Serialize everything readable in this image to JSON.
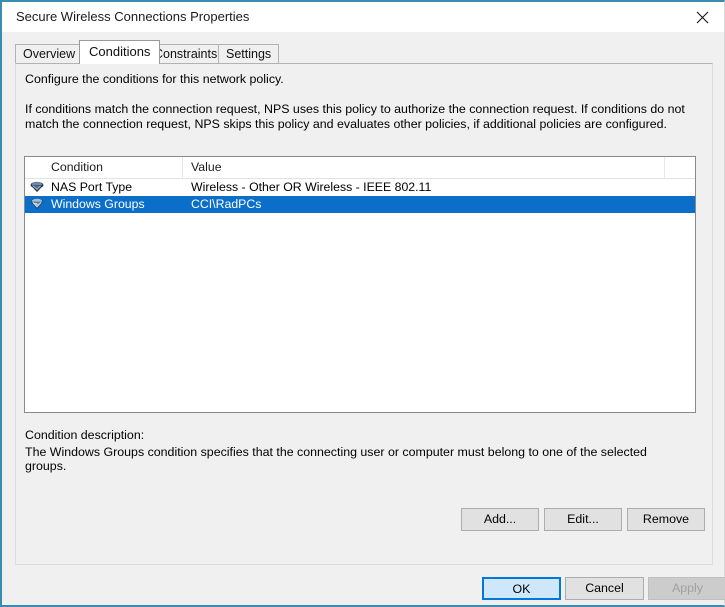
{
  "window": {
    "title": "Secure Wireless Connections Properties",
    "close_icon": "close-icon",
    "accent_border": "#3a8db0",
    "body_bg": "#f0f0f0"
  },
  "tabs": [
    {
      "label": "Overview",
      "selected": false
    },
    {
      "label": "Conditions",
      "selected": true
    },
    {
      "label": "Constraints",
      "selected": false
    },
    {
      "label": "Settings",
      "selected": false
    }
  ],
  "panel": {
    "intro_line1": "Configure the conditions for this network policy.",
    "intro_line2": "If conditions match the connection request, NPS uses this policy to authorize the connection request. If conditions do not match the connection request, NPS skips this policy and evaluates other policies, if additional policies are configured."
  },
  "list": {
    "columns": [
      "Condition",
      "Value"
    ],
    "selection_color": "#0b6fc9",
    "rows": [
      {
        "icon": "nas-port-type-icon",
        "condition": "NAS Port Type",
        "value": "Wireless - Other OR Wireless - IEEE 802.11",
        "selected": false
      },
      {
        "icon": "windows-groups-icon",
        "condition": "Windows Groups",
        "value": "CCI\\RadPCs",
        "selected": true
      }
    ]
  },
  "description": {
    "label": "Condition description:",
    "text": "The Windows Groups condition specifies that the connecting user or computer must belong to one of the selected groups."
  },
  "actions": {
    "add": "Add...",
    "edit": "Edit...",
    "remove": "Remove"
  },
  "footer": {
    "ok": "OK",
    "cancel": "Cancel",
    "apply": "Apply",
    "apply_disabled": true,
    "default_button_accent": "#0078d7"
  }
}
